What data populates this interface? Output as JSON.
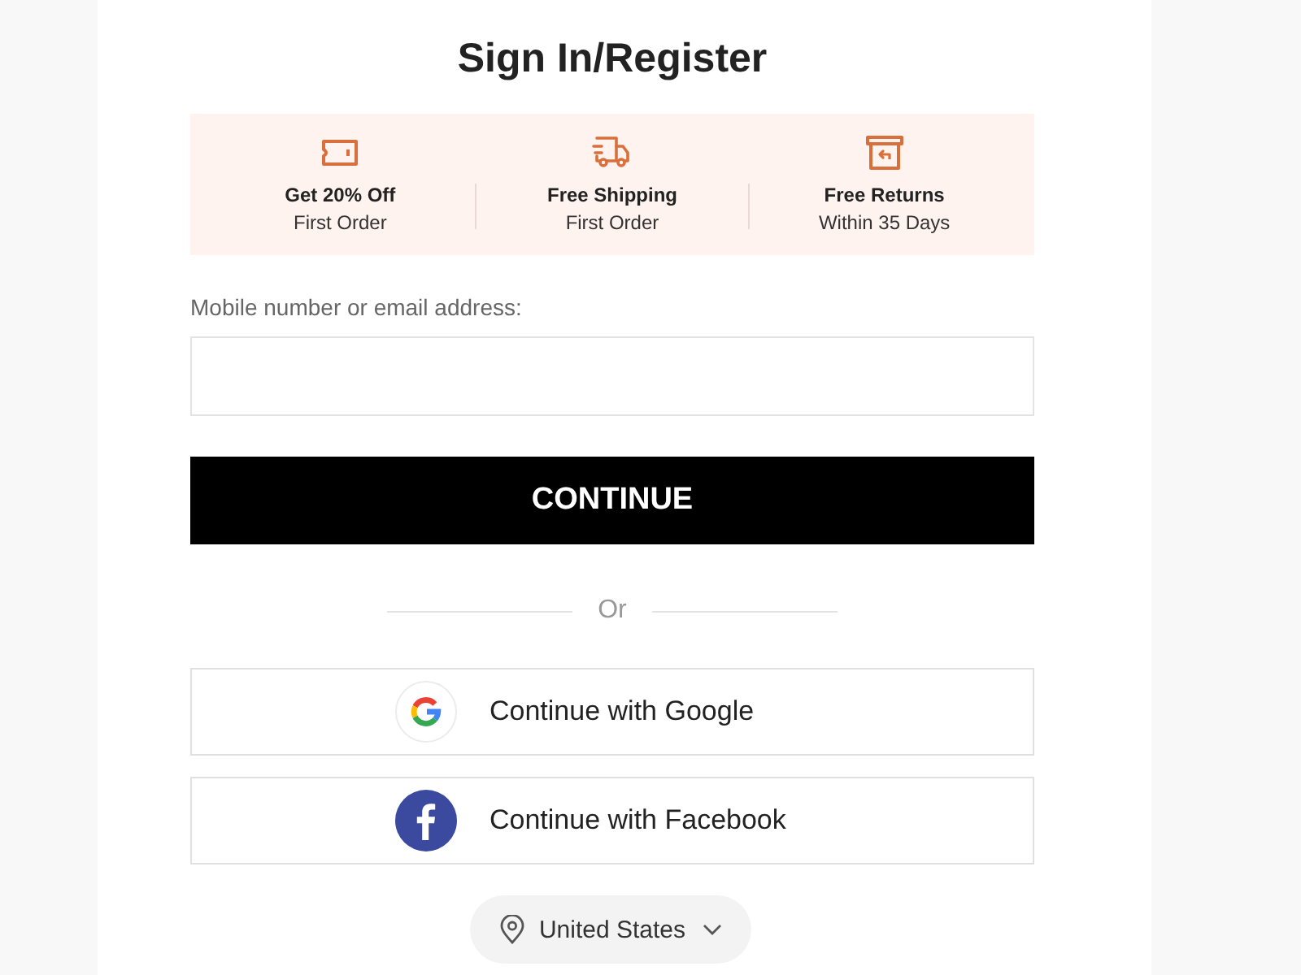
{
  "page": {
    "title": "Sign In/Register"
  },
  "perks": [
    {
      "kind": "coupon",
      "title": "Get 20% Off",
      "subtitle": "First Order"
    },
    {
      "kind": "truck",
      "title": "Free Shipping",
      "subtitle": "First Order"
    },
    {
      "kind": "returns",
      "title": "Free Returns",
      "subtitle": "Within 35 Days"
    }
  ],
  "login": {
    "label": "Mobile number or email address:",
    "button": "CONTINUE"
  },
  "separator": {
    "text": "Or"
  },
  "social": [
    {
      "kind": "google",
      "label": "Continue with Google"
    },
    {
      "kind": "facebook",
      "label": "Continue with Facebook"
    }
  ],
  "region": {
    "label": "United States"
  }
}
